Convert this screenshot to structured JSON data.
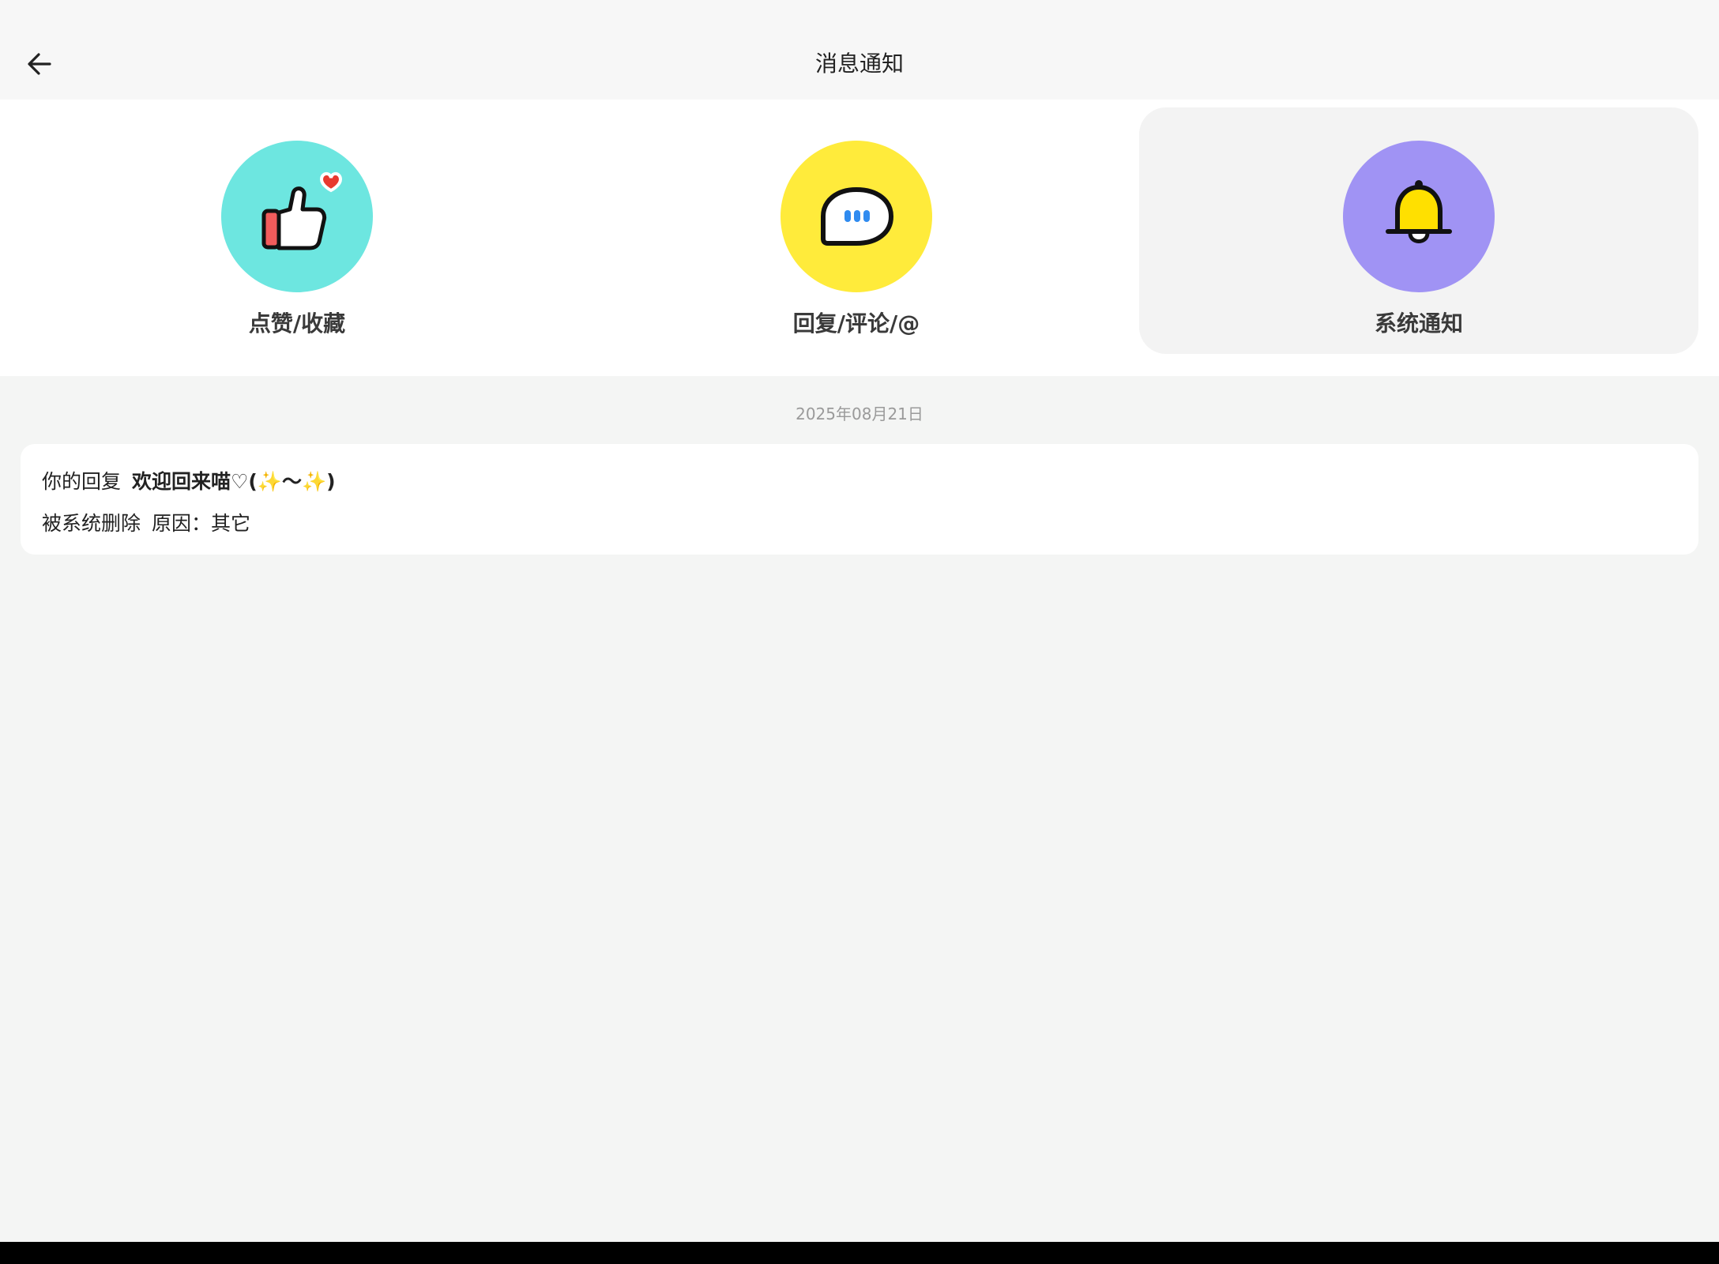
{
  "header": {
    "back_icon": "arrow-left-icon",
    "title": "消息通知"
  },
  "categories": [
    {
      "label": "点赞/收藏",
      "icon": "thumbs-up-heart-icon",
      "color": "#6de6e0",
      "selected": false
    },
    {
      "label": "回复/评论/@",
      "icon": "chat-bubble-icon",
      "color": "#ffeb3b",
      "selected": false
    },
    {
      "label": "系统通知",
      "icon": "bell-icon",
      "color": "#a093f4",
      "selected": true
    }
  ],
  "notices": {
    "date": "2025年08月21日",
    "items": [
      {
        "prefix": "你的回复",
        "content": "欢迎回来喵♡(✨〜✨)",
        "action": "被系统删除",
        "reason": "原因：其它"
      }
    ]
  }
}
